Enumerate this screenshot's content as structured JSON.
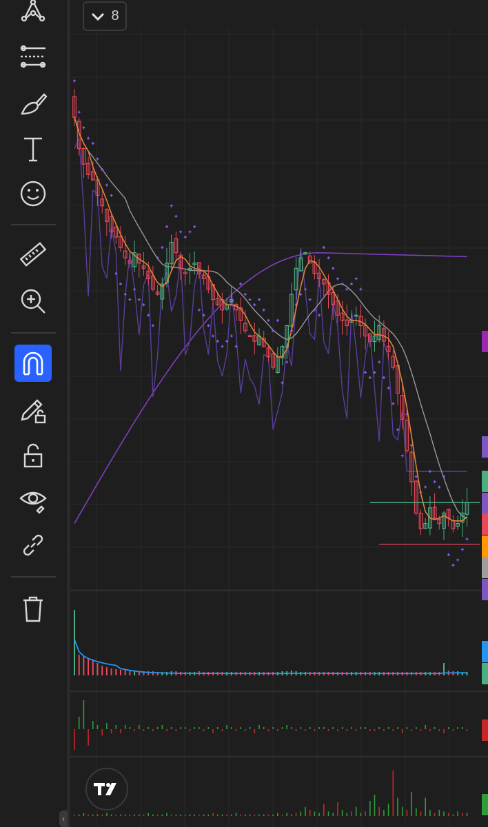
{
  "pane_toggle": {
    "count": "8",
    "icon": "chevron-down-icon"
  },
  "toolbar": {
    "tools": [
      {
        "name": "pattern-tool",
        "icon": "pattern-icon"
      },
      {
        "name": "fib-tool",
        "icon": "fib-retracement-icon"
      },
      {
        "name": "brush-tool",
        "icon": "brush-icon"
      },
      {
        "name": "text-tool",
        "icon": "text-icon"
      },
      {
        "name": "emoji-tool",
        "icon": "smiley-icon"
      },
      {
        "name": "measure-tool",
        "icon": "ruler-icon"
      },
      {
        "name": "zoom-tool",
        "icon": "zoom-in-icon"
      },
      {
        "name": "magnet-tool",
        "icon": "magnet-icon",
        "active": true
      },
      {
        "name": "lock-drawings-tool",
        "icon": "pencil-lock-icon"
      },
      {
        "name": "lock-all-tool",
        "icon": "unlock-icon"
      },
      {
        "name": "hide-tool",
        "icon": "eye-icon"
      },
      {
        "name": "sync-tool",
        "icon": "link-icon"
      },
      {
        "name": "delete-tool",
        "icon": "trash-icon"
      }
    ]
  },
  "logo": {
    "icon": "tradingview-logo-icon"
  },
  "colors": {
    "up": "#4caf82",
    "down": "#e8485a",
    "sar": "#8b5cf6",
    "ma_fast": "#e0843a",
    "ma_mid": "#9a9a9a",
    "ma_slow": "#7e3fbf",
    "line_indicator": "#5b3d9c",
    "volume_ma": "#2196f3",
    "osc_up": "#2e9e3a",
    "osc_down": "#c62828",
    "support": "#e8485a",
    "resistance": "#4caf82",
    "accent": "#2962ff"
  },
  "price_scale_tabs": [
    "#9c27b0",
    "#7e57c2",
    "#4caf82",
    "#7e57c2",
    "#e8485a",
    "#ff9800",
    "#9e9e9e",
    "#7e57c2",
    "#2196f3",
    "#4caf82",
    "#c62828",
    "#2e9e3a"
  ],
  "chart_data": {
    "type": "candlestick",
    "price_closes": [
      86,
      80,
      77,
      75,
      74,
      71,
      69,
      66,
      64,
      63,
      61,
      59,
      58,
      60,
      58,
      57,
      55,
      53,
      52,
      54,
      58,
      62,
      60,
      57,
      56,
      57,
      58,
      56,
      55,
      53,
      51,
      50,
      49,
      50,
      51,
      49,
      47,
      45,
      44,
      43,
      44,
      42,
      40,
      38,
      40,
      42,
      46,
      52,
      57,
      59,
      60,
      58,
      56,
      55,
      54,
      52,
      50,
      48,
      47,
      46,
      47,
      48,
      46,
      44,
      43,
      44,
      46,
      43,
      41,
      38,
      33,
      28,
      22,
      16,
      10,
      7,
      8,
      11,
      9,
      8,
      10,
      9,
      7,
      8,
      10,
      12
    ],
    "volume": [
      95,
      30,
      28,
      25,
      22,
      18,
      14,
      12,
      10,
      9,
      8,
      8,
      7,
      7,
      6,
      6,
      6,
      6,
      5,
      5,
      5,
      6,
      6,
      5,
      5,
      5,
      5,
      6,
      5,
      5,
      5,
      5,
      5,
      5,
      5,
      5,
      5,
      5,
      5,
      5,
      5,
      5,
      5,
      5,
      5,
      6,
      6,
      7,
      6,
      5,
      5,
      5,
      5,
      5,
      5,
      5,
      5,
      5,
      5,
      5,
      5,
      5,
      5,
      5,
      5,
      5,
      5,
      5,
      5,
      5,
      5,
      5,
      5,
      5,
      5,
      5,
      5,
      5,
      5,
      5,
      18,
      7,
      6,
      6,
      5,
      5
    ],
    "oscillator": [
      -10,
      6,
      14,
      -8,
      4,
      2,
      -3,
      3,
      -2,
      2,
      -2,
      2,
      1,
      -1,
      2,
      -1,
      1,
      -1,
      1,
      2,
      -1,
      1,
      -1,
      1,
      1,
      -1,
      1,
      1,
      -1,
      1,
      -2,
      1,
      -1,
      2,
      1,
      -1,
      1,
      -1,
      1,
      -2,
      2,
      1,
      -1,
      1,
      -1,
      1,
      2,
      1,
      -1,
      1,
      -1,
      1,
      -1,
      1,
      1,
      -1,
      1,
      -1,
      1,
      -1,
      1,
      -1,
      1,
      1,
      -1,
      -1,
      1,
      -1,
      1,
      -1,
      1,
      -2,
      1,
      -1,
      1,
      -1,
      2,
      -1,
      1,
      -1,
      -2,
      1,
      -1,
      1,
      1,
      -1
    ],
    "bottom_volume": [
      1,
      1,
      2,
      1,
      1,
      1,
      1,
      2,
      1,
      1,
      1,
      1,
      1,
      1,
      1,
      1,
      2,
      1,
      1,
      1,
      2,
      1,
      1,
      1,
      1,
      1,
      1,
      1,
      1,
      1,
      2,
      1,
      1,
      1,
      1,
      2,
      1,
      1,
      1,
      1,
      1,
      1,
      1,
      1,
      2,
      1,
      2,
      1,
      2,
      3,
      6,
      4,
      3,
      2,
      8,
      3,
      2,
      9,
      4,
      2,
      3,
      6,
      2,
      3,
      10,
      14,
      6,
      4,
      8,
      30,
      12,
      6,
      4,
      16,
      5,
      3,
      12,
      4,
      2,
      4,
      3,
      2,
      1,
      3,
      2,
      2
    ]
  }
}
